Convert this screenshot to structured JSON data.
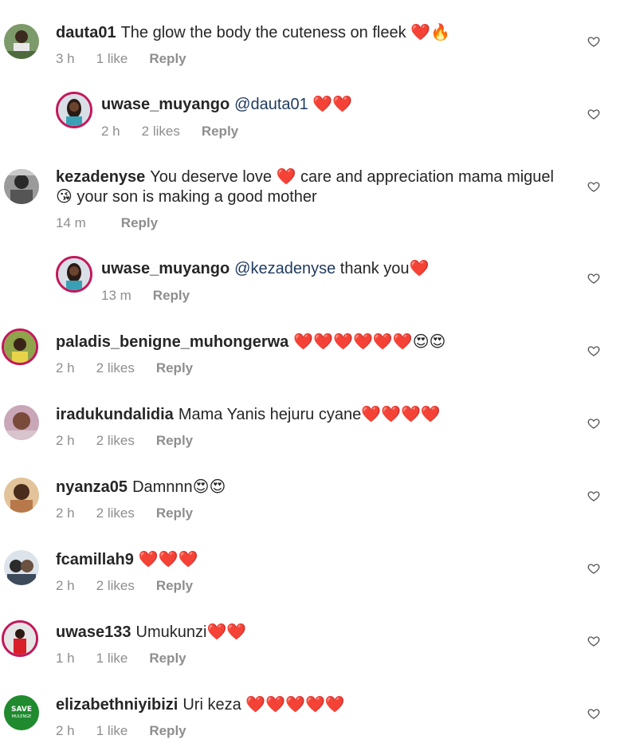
{
  "comments": [
    {
      "user": "dauta01",
      "text": "The glow the body the cuteness on fleek",
      "emojis": "❤️🔥",
      "time": "3 h",
      "likes": "1 like",
      "reply": "Reply"
    },
    {
      "user": "uwase_muyango",
      "mention": "@dauta01",
      "text": "",
      "emojis": "❤️❤️",
      "time": "2 h",
      "likes": "2 likes",
      "reply": "Reply"
    },
    {
      "user": "kezadenyse",
      "text": "You deserve love",
      "text2": "care and appreciation mama miguel",
      "line2": "your son is making a good mother",
      "emojis": "❤️",
      "emojis2": "😘",
      "time": "14 m",
      "reply": "Reply"
    },
    {
      "user": "uwase_muyango",
      "mention": "@kezadenyse",
      "text": "thank you",
      "emojis": "❤️",
      "time": "13 m",
      "reply": "Reply"
    },
    {
      "user": "paladis_benigne_muhongerwa",
      "text": "",
      "emojis": "❤️❤️❤️❤️❤️❤️😍😍",
      "time": "2 h",
      "likes": "2 likes",
      "reply": "Reply"
    },
    {
      "user": "iradukundalidia",
      "text": "Mama Yanis hejuru cyane",
      "emojis": "❤️❤️❤️❤️",
      "time": "2 h",
      "likes": "2 likes",
      "reply": "Reply"
    },
    {
      "user": "nyanza05",
      "text": "Damnnn",
      "emojis": "😍😍",
      "time": "2 h",
      "likes": "2 likes",
      "reply": "Reply"
    },
    {
      "user": "fcamillah9",
      "text": "",
      "emojis": "❤️❤️❤️",
      "time": "2 h",
      "likes": "2 likes",
      "reply": "Reply"
    },
    {
      "user": "uwase133",
      "text": "Umukunzi",
      "emojis": "❤️❤️",
      "time": "1 h",
      "likes": "1 like",
      "reply": "Reply"
    },
    {
      "user": "elizabethniyibizi",
      "text": "Uri keza",
      "emojis": "❤️❤️❤️❤️❤️",
      "time": "2 h",
      "likes": "1 like",
      "reply": "Reply",
      "avatar_text": "SAVE MULENGE"
    }
  ],
  "icons": {
    "like": "heart-outline-icon"
  },
  "colors": {
    "username": "#262626",
    "meta": "#8e8e8e",
    "mention": "#1e3a5f",
    "heart": "#e0112b",
    "story_ring": "#c2185b"
  }
}
